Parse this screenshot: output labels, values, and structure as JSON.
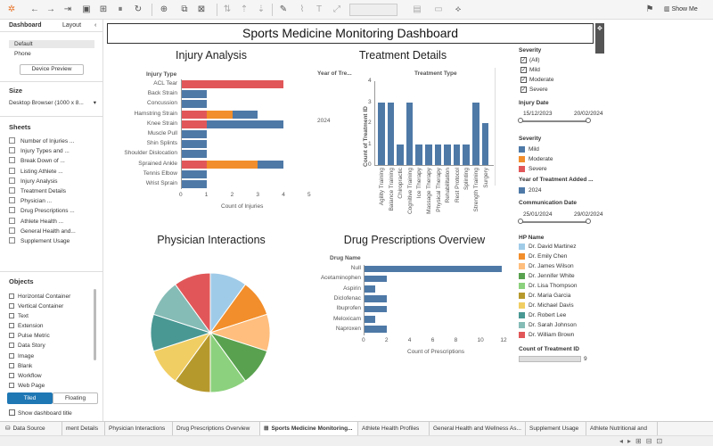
{
  "toolbar": {
    "show_me_label": "Show Me",
    "icons": [
      "tableau-logo-icon",
      "undo-icon",
      "redo-icon",
      "forward-icon",
      "save-icon",
      "new-datasource-icon",
      "pause-icon",
      "refresh-icon",
      "new-sheet-icon",
      "duplicate-icon",
      "clear-icon",
      "swap-icon",
      "sort-asc-icon",
      "sort-desc-icon",
      "highlight-icon",
      "group-icon",
      "label-icon",
      "fit-icon",
      "show-cards-icon",
      "share-icon",
      "present-icon"
    ]
  },
  "left_panel": {
    "tabs": [
      "Dashboard",
      "Layout"
    ],
    "active_tab": "Dashboard",
    "devices": [
      "Default",
      "Phone"
    ],
    "device_preview_label": "Device Preview",
    "size_heading": "Size",
    "size_value": "Desktop Browser (1000 x 8...",
    "sheets_heading": "Sheets",
    "sheets": [
      "Number of Injuries ...",
      "Injury Types and ...",
      "Break Down of ...",
      "Listing Athlete ...",
      "Injury Analysis",
      "Treatment Details",
      "Physician ...",
      "Drug Prescriptions ...",
      "Athlete Health ...",
      "General Health and...",
      "Supplement Usage"
    ],
    "objects_heading": "Objects",
    "objects": [
      "Horizontal Container",
      "Vertical Container",
      "Text",
      "Extension",
      "Pulse Metric",
      "Data Story",
      "Image",
      "Blank",
      "Workflow",
      "Web Page"
    ],
    "tiled_label": "Tiled",
    "floating_label": "Floating",
    "show_title_label": "Show dashboard title"
  },
  "dashboard": {
    "title": "Sports Medicine Monitoring Dashboard"
  },
  "chart_data": [
    {
      "type": "bar",
      "title": "Injury Analysis",
      "ylabel": "Injury Type",
      "xlabel": "Count of Injuries",
      "orientation": "horizontal",
      "stacked": true,
      "xlim": [
        0,
        5
      ],
      "xticks": [
        "0",
        "1",
        "2",
        "3",
        "4",
        "5"
      ],
      "categories": [
        "ACL Tear",
        "Back Strain",
        "Concussion",
        "Hamstring Strain",
        "Knee Strain",
        "Muscle Pull",
        "Shin Splints",
        "Shoulder Dislocation",
        "Sprained Ankle",
        "Tennis Elbow",
        "Wrist Sprain"
      ],
      "series": [
        {
          "name": "Severe",
          "color": "#e15759",
          "values": [
            4,
            0,
            0,
            1,
            1,
            0,
            0,
            0,
            1,
            0,
            0
          ]
        },
        {
          "name": "Moderate",
          "color": "#f28e2b",
          "values": [
            0,
            0,
            0,
            1,
            0,
            0,
            0,
            0,
            2,
            0,
            0
          ]
        },
        {
          "name": "Mild",
          "color": "#4e79a7",
          "values": [
            0,
            1,
            1,
            1,
            3,
            1,
            1,
            1,
            1,
            1,
            1
          ]
        }
      ]
    },
    {
      "type": "bar",
      "title": "Treatment Details",
      "row_header": "Year of Tre...",
      "col_header": "Treatment Type",
      "ylabel": "Count of Treatment ID",
      "row_label": "2024",
      "ylim": [
        0,
        4
      ],
      "yticks": [
        "0",
        "1",
        "2",
        "3",
        "4"
      ],
      "color": "#4e79a7",
      "categories": [
        "Agility Training",
        "Balance Training",
        "Chiropractic",
        "Cognitive Training",
        "Ice Therapy",
        "Massage Therapy",
        "Physical Therapy",
        "Rehabilitation",
        "Rest Protocol",
        "Splinting",
        "Strength Training",
        "Surgery"
      ],
      "values": [
        3,
        3,
        1,
        3,
        1,
        1,
        1,
        1,
        1,
        1,
        3,
        2
      ]
    },
    {
      "type": "pie",
      "title": "Physician Interactions",
      "categories": [
        "Dr. David Martinez",
        "Dr. Emily Chen",
        "Dr. James Wilson",
        "Dr. Jennifer White",
        "Dr. Lisa Thompson",
        "Dr. Maria Garcia",
        "Dr. Michael Davis",
        "Dr. Robert Lee",
        "Dr. Sarah Johnson",
        "Dr. William Brown"
      ],
      "values": [
        1,
        1,
        1,
        1,
        1,
        1,
        1,
        1,
        1,
        1
      ],
      "colors": [
        "#a0cbe8",
        "#f28e2b",
        "#ffbe7d",
        "#59a14f",
        "#8cd17d",
        "#b6992d",
        "#f1ce63",
        "#499894",
        "#86bcb6",
        "#e15759"
      ]
    },
    {
      "type": "bar",
      "title": "Drug Prescriptions Overview",
      "ylabel": "Drug Name",
      "xlabel": "Count of Prescriptions",
      "orientation": "horizontal",
      "xlim": [
        0,
        12
      ],
      "xticks": [
        "0",
        "2",
        "4",
        "6",
        "8",
        "10",
        "12"
      ],
      "color": "#4e79a7",
      "categories": [
        "Null",
        "Acetaminophen",
        "Aspirin",
        "Diclofenac",
        "Ibuprofen",
        "Meloxicam",
        "Naproxen"
      ],
      "values": [
        12,
        2,
        1,
        2,
        2,
        1,
        2
      ]
    }
  ],
  "filters": {
    "severity_heading": "Severity",
    "severity_options": [
      "(All)",
      "Mild",
      "Moderate",
      "Severe"
    ],
    "injury_date_heading": "Injury Date",
    "injury_date_start": "15/12/2023",
    "injury_date_end": "20/02/2024",
    "severity_legend_heading": "Severity",
    "severity_legend": [
      {
        "label": "Mild",
        "color": "#4e79a7"
      },
      {
        "label": "Moderate",
        "color": "#f28e2b"
      },
      {
        "label": "Severe",
        "color": "#e15759"
      }
    ],
    "year_heading": "Year of Treatment Added ...",
    "year_legend": [
      {
        "label": "2024",
        "color": "#4e79a7"
      }
    ],
    "comm_date_heading": "Communication Date",
    "comm_date_start": "25/01/2024",
    "comm_date_end": "29/02/2024",
    "hp_heading": "HP Name",
    "count_heading": "Count of Treatment ID",
    "count_value": "9"
  },
  "bottom_tabs": {
    "tabs": [
      "Data Source",
      "ment Details",
      "Physician Interactions",
      "Drug Prescriptions Overview",
      "Sports Medicine Monitoring...",
      "Athlete Health Profiles",
      "General Health and Wellness As...",
      "Supplement Usage",
      "Athlete Nutritional and"
    ],
    "active_tab": "Sports Medicine Monitoring..."
  }
}
